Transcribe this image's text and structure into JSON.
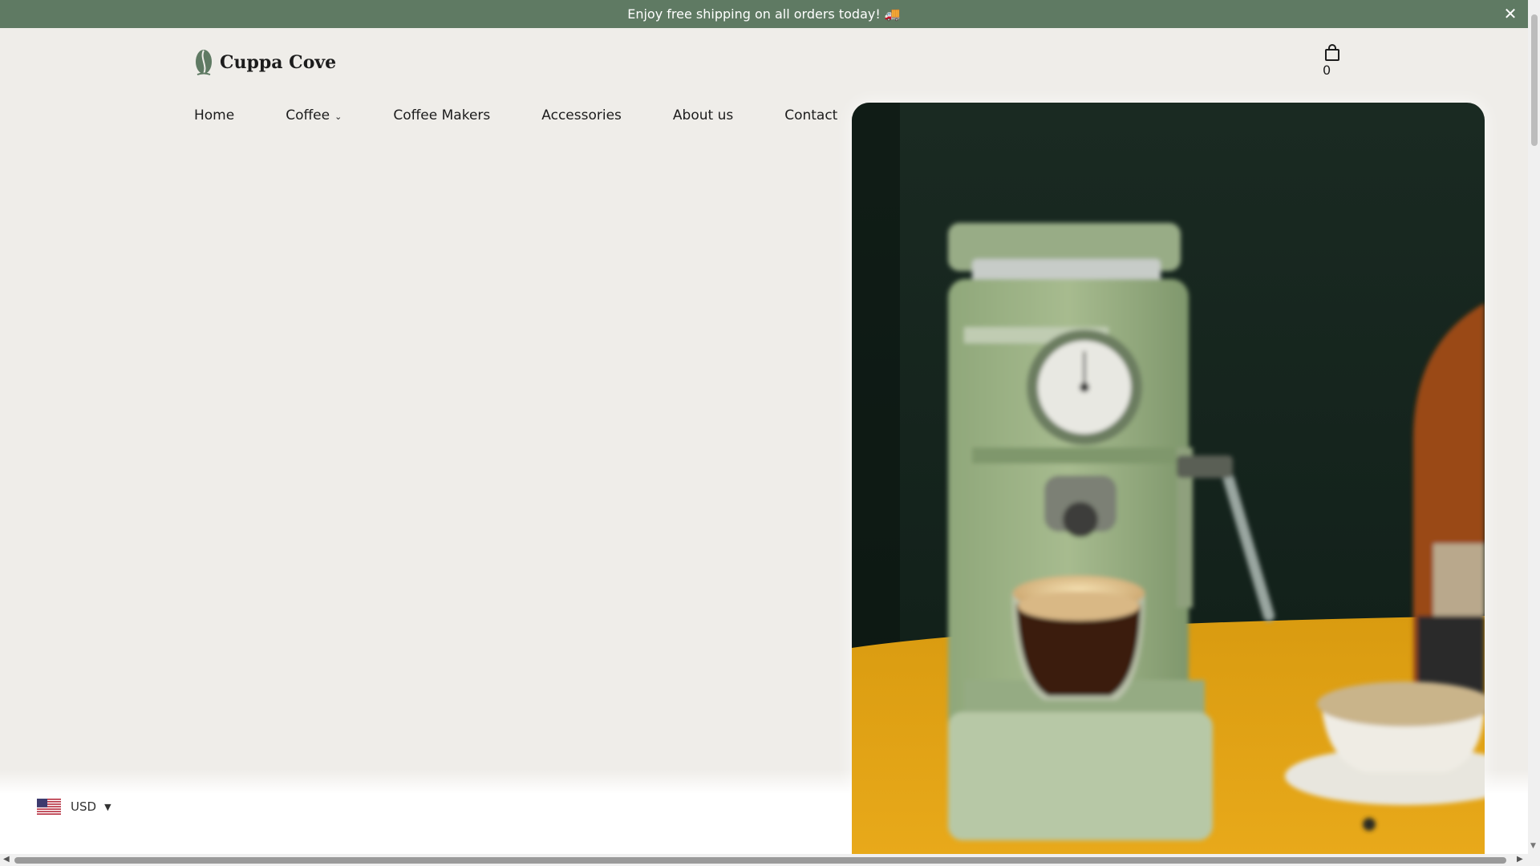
{
  "announcement": {
    "text": "Enjoy free shipping on all orders today! 🚚",
    "close_icon": "close-icon",
    "background": "#5f7a63"
  },
  "header": {
    "brand": "Cuppa Cove",
    "logo_icon": "coffee-bean-icon",
    "cart_icon": "shopping-bag-icon",
    "cart_count": "0"
  },
  "nav": {
    "items": [
      {
        "label": "Home"
      },
      {
        "label": "Coffee"
      },
      {
        "label": "Coffee Makers"
      },
      {
        "label": "Accessories"
      },
      {
        "label": "About us"
      },
      {
        "label": "Contact"
      }
    ]
  },
  "hero": {
    "image": "hero-espresso-machine-image",
    "background": "#efede9"
  },
  "currency": {
    "flag_icon": "us-flag-icon",
    "label": "USD",
    "caret_icon": "caret-down-icon"
  }
}
